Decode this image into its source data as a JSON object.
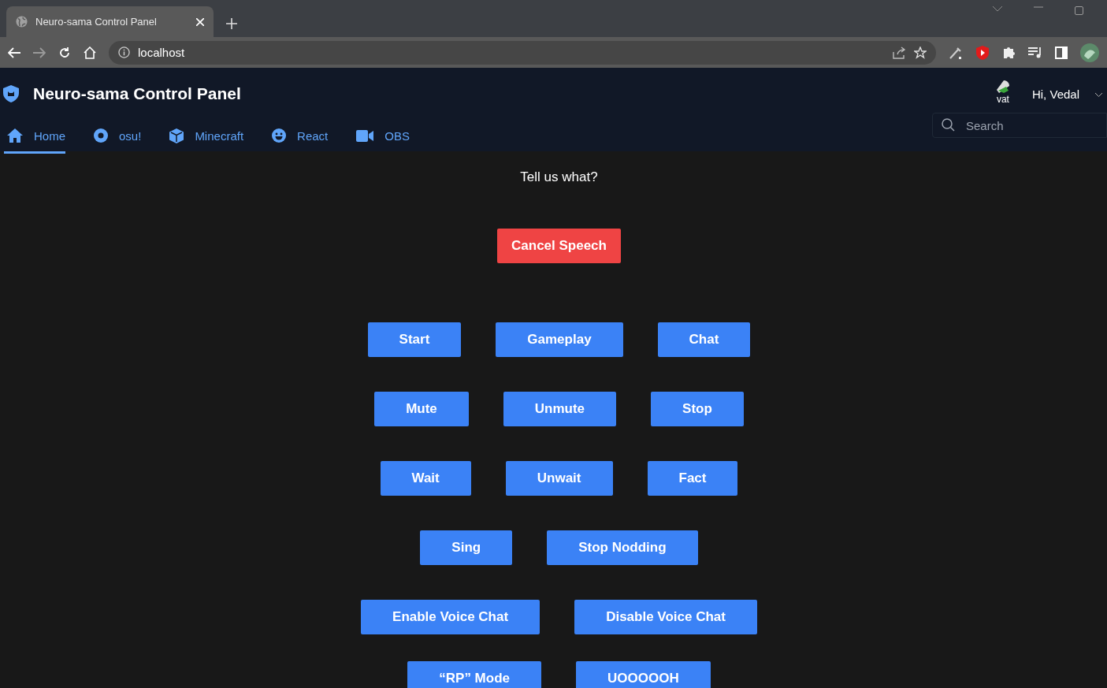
{
  "browser": {
    "tab_title": "Neuro-sama Control Panel",
    "address": "localhost"
  },
  "header": {
    "title": "Neuro-sama Control Panel",
    "greeting": "Hi, Vedal",
    "avatar_alt": "vat"
  },
  "nav": [
    {
      "label": "Home",
      "selected": true
    },
    {
      "label": "osu!",
      "selected": false
    },
    {
      "label": "Minecraft",
      "selected": false
    },
    {
      "label": "React",
      "selected": false
    },
    {
      "label": "OBS",
      "selected": false
    }
  ],
  "search": {
    "placeholder": "Search"
  },
  "prompt": "Tell us what?",
  "cancel_button": "Cancel Speech",
  "button_rows": [
    [
      "Start",
      "Gameplay",
      "Chat"
    ],
    [
      "Mute",
      "Unmute",
      "Stop"
    ],
    [
      "Wait",
      "Unwait",
      "Fact"
    ],
    [
      "Sing",
      "Stop Nodding"
    ],
    [
      "Enable Voice Chat",
      "Disable Voice Chat"
    ],
    [
      "“RP” Mode",
      "UOOOOOH"
    ]
  ]
}
